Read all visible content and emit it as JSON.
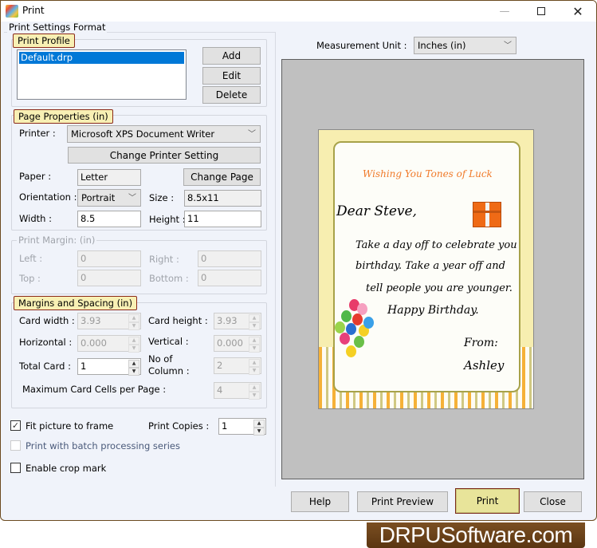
{
  "window": {
    "title": "Print",
    "minimize_icon": "minimize-icon",
    "maximize_icon": "maximize-icon",
    "close_icon": "close-icon"
  },
  "settings": {
    "group_title": "Print Settings Format",
    "print_profile": {
      "title": "Print Profile",
      "profiles": [
        "Default.drp"
      ],
      "selected": "Default.drp",
      "add_label": "Add",
      "edit_label": "Edit",
      "delete_label": "Delete"
    },
    "page_properties": {
      "title": "Page Properties  (in)",
      "printer_label": "Printer :",
      "printer_value": "Microsoft XPS Document Writer",
      "change_printer_label": "Change Printer Setting",
      "paper_label": "Paper :",
      "paper_value": "Letter",
      "change_page_label": "Change Page",
      "orientation_label": "Orientation :",
      "orientation_value": "Portrait",
      "size_label": "Size :",
      "size_value": "8.5x11",
      "width_label": "Width :",
      "width_value": "8.5",
      "height_label": "Height :",
      "height_value": "11"
    },
    "print_margins": {
      "title": "Print Margin: (in)",
      "left_label": "Left :",
      "left_value": "0",
      "right_label": "Right :",
      "right_value": "0",
      "top_label": "Top :",
      "top_value": "0",
      "bottom_label": "Bottom :",
      "bottom_value": "0"
    },
    "margins_spacing": {
      "title": "Margins and Spacing  (in)",
      "card_width_label": "Card width :",
      "card_width_value": "3.93",
      "card_height_label": "Card height :",
      "card_height_value": "3.93",
      "horizontal_label": "Horizontal :",
      "horizontal_value": "0.000",
      "vertical_label": "Vertical :",
      "vertical_value": "0.000",
      "total_card_label": "Total Card :",
      "total_card_value": "1",
      "no_of_label_1": "No of",
      "no_of_label_2": "Column :",
      "no_of_column_value": "2",
      "max_cells_label": "Maximum Card Cells per Page :",
      "max_cells_value": "4"
    },
    "fit_picture_label": "Fit picture to frame",
    "fit_picture_checked": true,
    "print_copies_label": "Print Copies :",
    "print_copies_value": "1",
    "batch_label": "Print with batch processing series",
    "batch_checked": false,
    "crop_mark_label": "Enable crop mark",
    "crop_mark_checked": false
  },
  "measurement": {
    "label": "Measurement Unit :",
    "value": "Inches (in)"
  },
  "card": {
    "heading": "Wishing You Tones of Luck",
    "greeting": "Dear Steve,",
    "line1": "Take a day off to celebrate you",
    "line2": "birthday. Take a year off and",
    "line3": "tell people you are younger.",
    "line4": "Happy Birthday.",
    "from": "From:",
    "signature": "Ashley",
    "heading_color": "#f07a2a"
  },
  "footer": {
    "help_label": "Help",
    "preview_label": "Print Preview",
    "print_label": "Print",
    "close_label": "Close"
  },
  "brand": {
    "text": "DRPUSoftware.com"
  }
}
